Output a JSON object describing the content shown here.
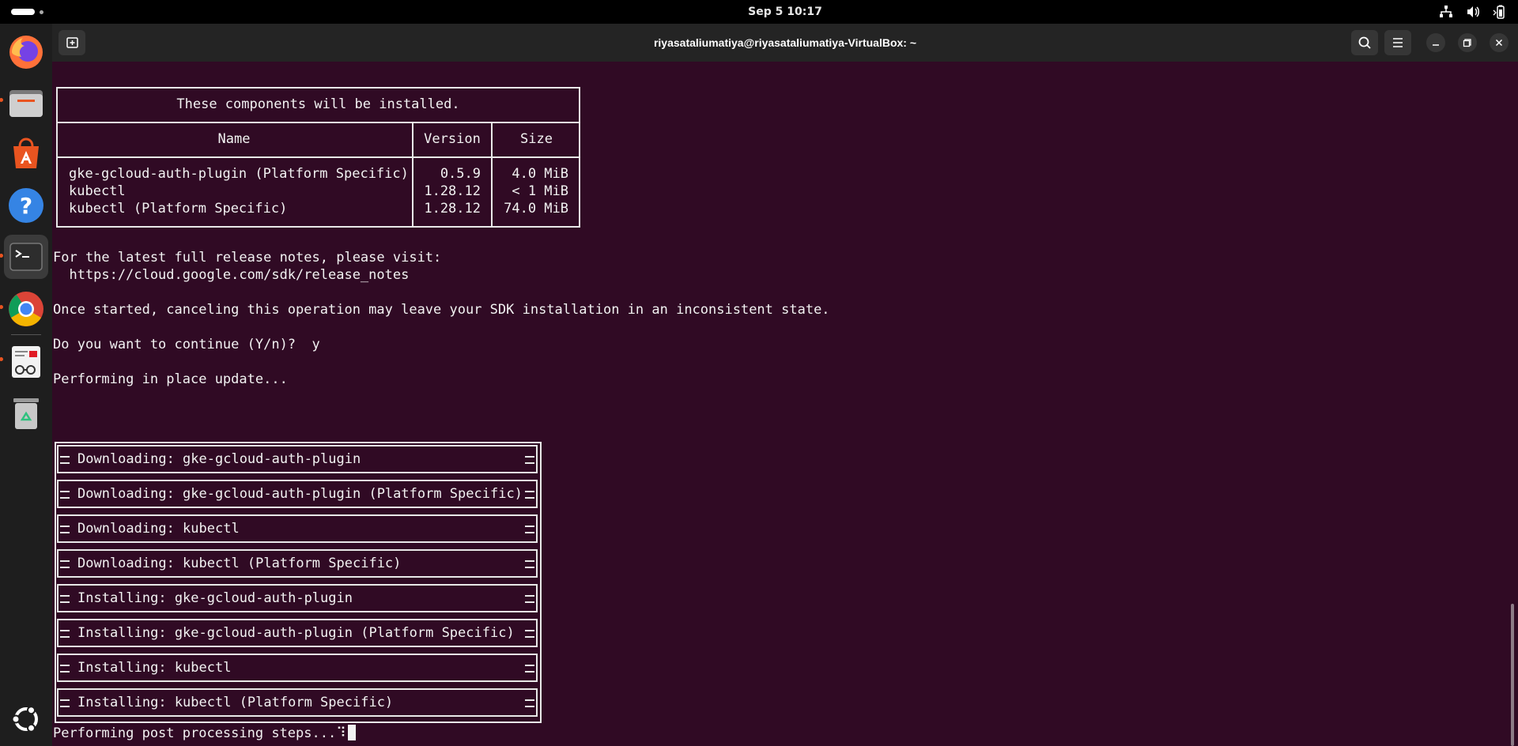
{
  "topbar": {
    "clock": "Sep 5  10:17",
    "icons": [
      "network-icon",
      "volume-icon",
      "battery-icon"
    ]
  },
  "dock": {
    "apps": [
      {
        "name": "firefox-icon",
        "running": false
      },
      {
        "name": "files-icon",
        "running": true
      },
      {
        "name": "app-center-icon",
        "running": false
      },
      {
        "name": "help-icon",
        "running": false
      },
      {
        "name": "terminal-icon",
        "running": true,
        "active": true
      },
      {
        "name": "chrome-icon",
        "running": true
      },
      {
        "name": "text-editor-icon",
        "running": true
      },
      {
        "name": "trash-icon",
        "running": false
      }
    ],
    "show_apps": "ubuntu-logo-icon"
  },
  "window": {
    "title": "riyasataliumatiya@riyasataliumatiya-VirtualBox: ~"
  },
  "terminal": {
    "components_table": {
      "heading": "These components will be installed.",
      "columns": [
        "Name",
        "Version",
        "Size"
      ],
      "rows": [
        {
          "name": "gke-gcloud-auth-plugin (Platform Specific)",
          "version": "0.5.9",
          "size": "4.0 MiB"
        },
        {
          "name": "kubectl",
          "version": "1.28.12",
          "size": "< 1 MiB"
        },
        {
          "name": "kubectl (Platform Specific)",
          "version": "1.28.12",
          "size": "74.0 MiB"
        }
      ]
    },
    "notes_line": "For the latest full release notes, please visit:",
    "notes_url": "  https://cloud.google.com/sdk/release_notes",
    "warning": "Once started, canceling this operation may leave your SDK installation in an inconsistent state.",
    "prompt": "Do you want to continue (Y/n)?  y",
    "performing": "Performing in place update...",
    "progress_steps": [
      "Downloading: gke-gcloud-auth-plugin",
      "Downloading: gke-gcloud-auth-plugin (Platform Specific)",
      "Downloading: kubectl",
      "Downloading: kubectl (Platform Specific)",
      "Installing: gke-gcloud-auth-plugin",
      "Installing: gke-gcloud-auth-plugin (Platform Specific)",
      "Installing: kubectl",
      "Installing: kubectl (Platform Specific)"
    ],
    "post_processing": "Performing post processing steps...",
    "spinner": "⠹"
  },
  "colors": {
    "terminal_bg": "#300a24",
    "headerbar_bg": "#242424",
    "dock_bg": "#1e1e1e",
    "accent": "#e95420"
  }
}
